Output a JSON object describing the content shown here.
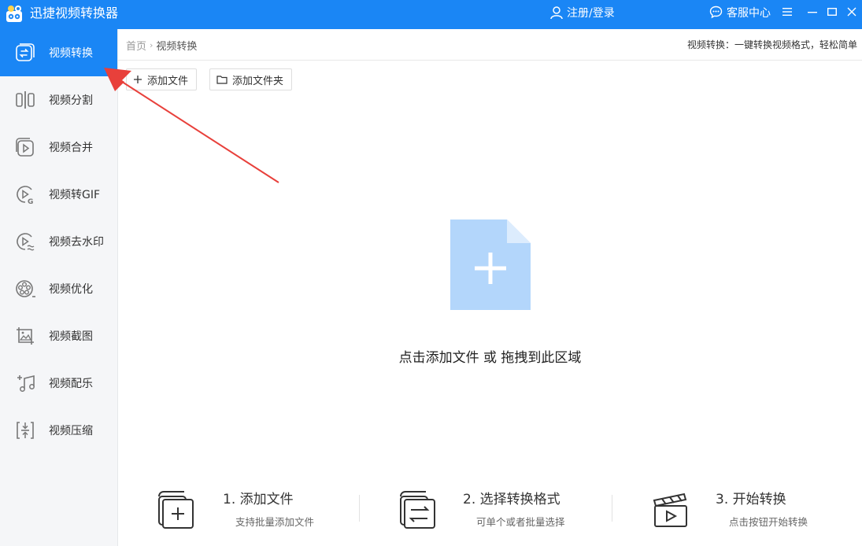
{
  "app": {
    "title": "迅捷视频转换器"
  },
  "header": {
    "account_label": "注册/登录",
    "service_label": "客服中心"
  },
  "sidebar": {
    "items": [
      {
        "label": "视频转换",
        "icon": "convert-icon",
        "active": true
      },
      {
        "label": "视频分割",
        "icon": "split-icon"
      },
      {
        "label": "视频合并",
        "icon": "merge-icon"
      },
      {
        "label": "视频转GIF",
        "icon": "gif-icon"
      },
      {
        "label": "视频去水印",
        "icon": "watermark-icon"
      },
      {
        "label": "视频优化",
        "icon": "optimize-icon"
      },
      {
        "label": "视频截图",
        "icon": "screenshot-icon"
      },
      {
        "label": "视频配乐",
        "icon": "music-icon"
      },
      {
        "label": "视频压缩",
        "icon": "compress-icon"
      }
    ]
  },
  "breadcrumb": {
    "home": "首页",
    "current": "视频转换"
  },
  "tagline": "视频转换：一键转换视频格式，轻松简单",
  "toolbar": {
    "add_file": "添加文件",
    "add_folder": "添加文件夹"
  },
  "dropzone": {
    "hint": "点击添加文件 或 拖拽到此区域"
  },
  "steps": [
    {
      "title": "1. 添加文件",
      "subtitle": "支持批量添加文件"
    },
    {
      "title": "2. 选择转换格式",
      "subtitle": "可单个或者批量选择"
    },
    {
      "title": "3. 开始转换",
      "subtitle": "点击按钮开始转换"
    }
  ],
  "colors": {
    "accent": "#1a86f5",
    "file_icon": "#b3d6fb",
    "annotation_arrow": "#e8403b"
  }
}
